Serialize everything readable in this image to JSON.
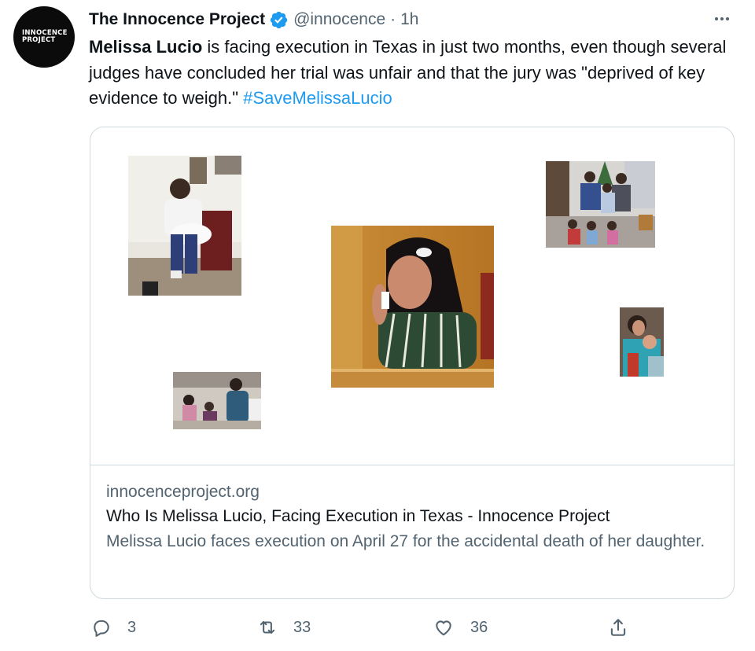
{
  "account": {
    "avatar_text_line1": "INNOCENCE",
    "avatar_text_line2": "PROJECT",
    "display_name": "The Innocence Project",
    "handle": "@innocence",
    "separator": "·",
    "time": "1h",
    "verified": true
  },
  "tweet": {
    "name_mention": "Melissa Lucio",
    "body": " is facing execution in Texas in just two months, even though several judges have concluded her trial was unfair and that the jury was \"deprived of key evidence to weigh.\" ",
    "hashtag": "#SaveMelissaLucio"
  },
  "card": {
    "domain": "innocenceproject.org",
    "title": "Who Is Melissa Lucio, Facing Execution in Texas - Innocence Project",
    "description": "Melissa Lucio faces execution on April 27 for the accidental death of her daughter."
  },
  "actions": {
    "replies": "3",
    "retweets": "33",
    "likes": "36"
  },
  "colors": {
    "accent": "#1d9bf0",
    "secondary_text": "#536471",
    "border": "#cfd9de"
  },
  "icons": {
    "more": "more-icon",
    "verified": "verified-badge-icon",
    "reply": "reply-icon",
    "retweet": "retweet-icon",
    "like": "heart-icon",
    "share": "share-icon"
  }
}
